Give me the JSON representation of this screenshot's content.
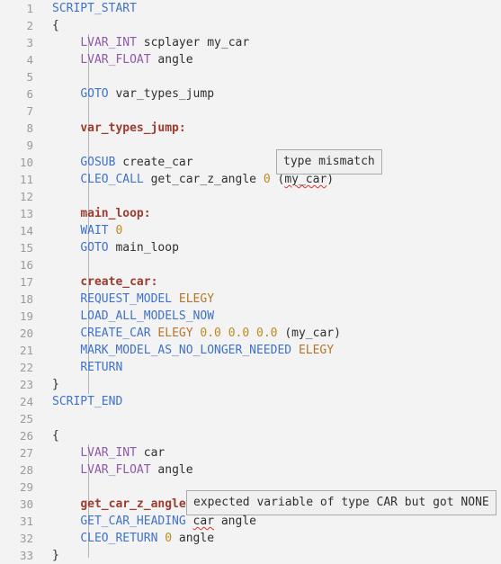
{
  "editor": {
    "background_color": "#f3f3f3",
    "gutter_color": "#9a9a9a",
    "indent_guide_color": "#b6b6b6",
    "error_squiggle_color": "#e03030",
    "total_lines_visible": 33
  },
  "colors": {
    "command": "#3f72c8",
    "type_keyword": "#8e5aa8",
    "label": "#9c3b2e",
    "number": "#bd8a1e",
    "model_name": "#b5762b",
    "plain": "#2f2f2f",
    "tooltip_background": "#f0f0f0",
    "tooltip_border": "#a9a9a9"
  },
  "gutter": {
    "numbers": [
      "1",
      "2",
      "3",
      "4",
      "5",
      "6",
      "7",
      "8",
      "9",
      "10",
      "11",
      "12",
      "13",
      "14",
      "15",
      "16",
      "17",
      "18",
      "19",
      "20",
      "21",
      "22",
      "23",
      "24",
      "25",
      "26",
      "27",
      "28",
      "29",
      "30",
      "31",
      "32",
      "33"
    ]
  },
  "code_lines": [
    {
      "n": "1",
      "text": "SCRIPT_START"
    },
    {
      "n": "2",
      "text": "{"
    },
    {
      "n": "3",
      "text": "    LVAR_INT scplayer my_car"
    },
    {
      "n": "4",
      "text": "    LVAR_FLOAT angle"
    },
    {
      "n": "5",
      "text": ""
    },
    {
      "n": "6",
      "text": "    GOTO var_types_jump"
    },
    {
      "n": "7",
      "text": ""
    },
    {
      "n": "8",
      "text": "    var_types_jump:"
    },
    {
      "n": "9",
      "text": ""
    },
    {
      "n": "10",
      "text": "    GOSUB create_car"
    },
    {
      "n": "11",
      "text": "    CLEO_CALL get_car_z_angle 0 (my_car)"
    },
    {
      "n": "12",
      "text": ""
    },
    {
      "n": "13",
      "text": "    main_loop:"
    },
    {
      "n": "14",
      "text": "    WAIT 0"
    },
    {
      "n": "15",
      "text": "    GOTO main_loop"
    },
    {
      "n": "16",
      "text": ""
    },
    {
      "n": "17",
      "text": "    create_car:"
    },
    {
      "n": "18",
      "text": "    REQUEST_MODEL ELEGY"
    },
    {
      "n": "19",
      "text": "    LOAD_ALL_MODELS_NOW"
    },
    {
      "n": "20",
      "text": "    CREATE_CAR ELEGY 0.0 0.0 0.0 (my_car)"
    },
    {
      "n": "21",
      "text": "    MARK_MODEL_AS_NO_LONGER_NEEDED ELEGY"
    },
    {
      "n": "22",
      "text": "    RETURN"
    },
    {
      "n": "23",
      "text": "}"
    },
    {
      "n": "24",
      "text": "SCRIPT_END"
    },
    {
      "n": "25",
      "text": ""
    },
    {
      "n": "26",
      "text": "{"
    },
    {
      "n": "27",
      "text": "    LVAR_INT car"
    },
    {
      "n": "28",
      "text": "    LVAR_FLOAT angle"
    },
    {
      "n": "29",
      "text": ""
    },
    {
      "n": "30",
      "text": "    get_car_z_angle:"
    },
    {
      "n": "31",
      "text": "    GET_CAR_HEADING car angle"
    },
    {
      "n": "32",
      "text": "    CLEO_RETURN 0 angle"
    },
    {
      "n": "33",
      "text": "}"
    }
  ],
  "tokens": {
    "script_start": "SCRIPT_START",
    "script_end": "SCRIPT_END",
    "brace_open": "{",
    "brace_close": "}",
    "lvar_int": "LVAR_INT",
    "lvar_float": "LVAR_FLOAT",
    "scplayer": "scplayer",
    "my_car": "my_car",
    "angle": "angle",
    "car": "car",
    "goto": "GOTO",
    "gosub": "GOSUB",
    "wait": "WAIT",
    "return": "RETURN",
    "cleo_call": "CLEO_CALL",
    "cleo_return": "CLEO_RETURN",
    "request_model": "REQUEST_MODEL",
    "load_all_models_now": "LOAD_ALL_MODELS_NOW",
    "create_car_cmd": "CREATE_CAR",
    "mark_model": "MARK_MODEL_AS_NO_LONGER_NEEDED",
    "get_car_heading": "GET_CAR_HEADING",
    "elegy": "ELEGY",
    "zero": "0",
    "zero_float": "0.0",
    "paren_open": "(",
    "paren_close": ")",
    "label_var_types_jump": "var_types_jump:",
    "label_main_loop": "main_loop:",
    "label_create_car": "create_car:",
    "label_get_car_z_angle": "get_car_z_angle:",
    "ref_var_types_jump": "var_types_jump",
    "ref_main_loop": "main_loop",
    "ref_create_car": "create_car",
    "ref_get_car_z_angle": "get_car_z_angle"
  },
  "tooltips": [
    {
      "id": "type-mismatch",
      "text": "type mismatch",
      "related_line": "11",
      "related_token": "my_car"
    },
    {
      "id": "expected-car",
      "text": "expected variable of type CAR but got NONE",
      "related_line": "31",
      "related_token": "car"
    }
  ]
}
